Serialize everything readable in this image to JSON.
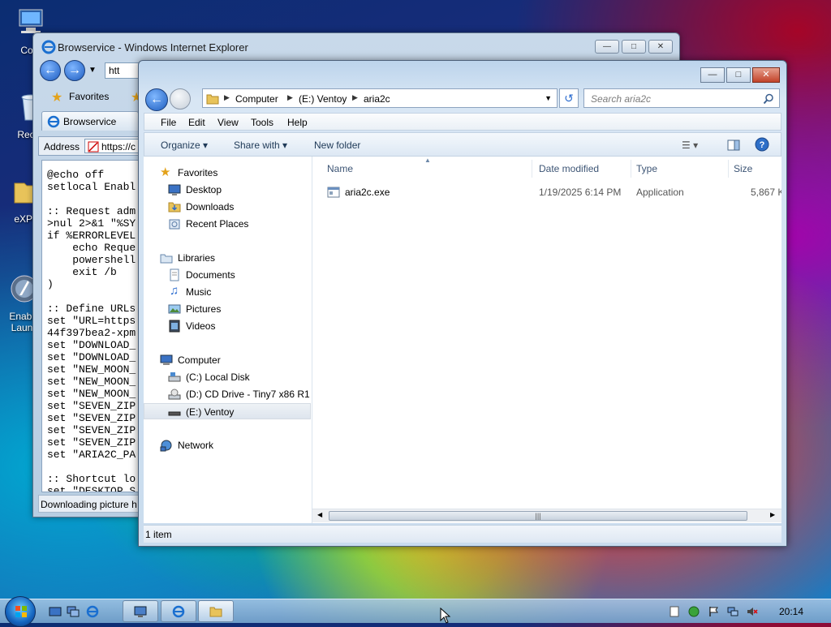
{
  "desktop": {
    "icons": [
      {
        "label": "Com",
        "icon": "computer-icon"
      },
      {
        "label": "Recyc",
        "icon": "recycle-bin-icon"
      },
      {
        "label": "eXPer",
        "icon": "folder-icon"
      },
      {
        "label": "Enable\nLaunc",
        "icon": "launcher-icon"
      }
    ]
  },
  "ie": {
    "title": "Browservice - Windows Internet Explorer",
    "address_partial": "htt",
    "favorites_label": "Favorites",
    "tab_label": "Browservice",
    "address_label": "Address",
    "address_url": "https://c",
    "script_text": "@echo off\nsetlocal Enabl\n\n:: Request adm\n>nul 2>&1 \"%SY\nif %ERRORLEVEL\n    echo Reque\n    powershell\n    exit /b\n)\n\n:: Define URLs\nset \"URL=https\n44f397bea2-xpm\nset \"DOWNLOAD_\nset \"DOWNLOAD_\nset \"NEW_MOON_\nset \"NEW_MOON_\nset \"NEW_MOON_\nset \"SEVEN_ZIP\nset \"SEVEN_ZIP\nset \"SEVEN_ZIP\nset \"SEVEN_ZIP\nset \"ARIA2C_PA\n\n:: Shortcut lo\nset \"DESKTOP_S",
    "status": "Downloading picture h"
  },
  "explorer": {
    "breadcrumb": [
      "Computer",
      "(E:) Ventoy",
      "aria2c"
    ],
    "search_placeholder": "Search aria2c",
    "menu": [
      "File",
      "Edit",
      "View",
      "Tools",
      "Help"
    ],
    "commands": {
      "organize": "Organize",
      "share_with": "Share with",
      "new_folder": "New folder"
    },
    "nav": {
      "favorites": {
        "label": "Favorites",
        "items": [
          "Desktop",
          "Downloads",
          "Recent Places"
        ]
      },
      "libraries": {
        "label": "Libraries",
        "items": [
          "Documents",
          "Music",
          "Pictures",
          "Videos"
        ]
      },
      "computer": {
        "label": "Computer",
        "items": [
          "(C:) Local Disk",
          "(D:) CD Drive - Tiny7 x86 R1",
          "(E:) Ventoy"
        ]
      },
      "network": {
        "label": "Network"
      }
    },
    "columns": [
      "Name",
      "Date modified",
      "Type",
      "Size"
    ],
    "files": [
      {
        "name": "aria2c.exe",
        "date": "1/19/2025 6:14 PM",
        "type": "Application",
        "size": "5,867 K"
      }
    ],
    "status": "1 item"
  },
  "taskbar": {
    "clock": "20:14"
  },
  "colors": {
    "selection": "#dee5ee",
    "link_blue": "#1e3957",
    "close_red": "#c2432a"
  }
}
